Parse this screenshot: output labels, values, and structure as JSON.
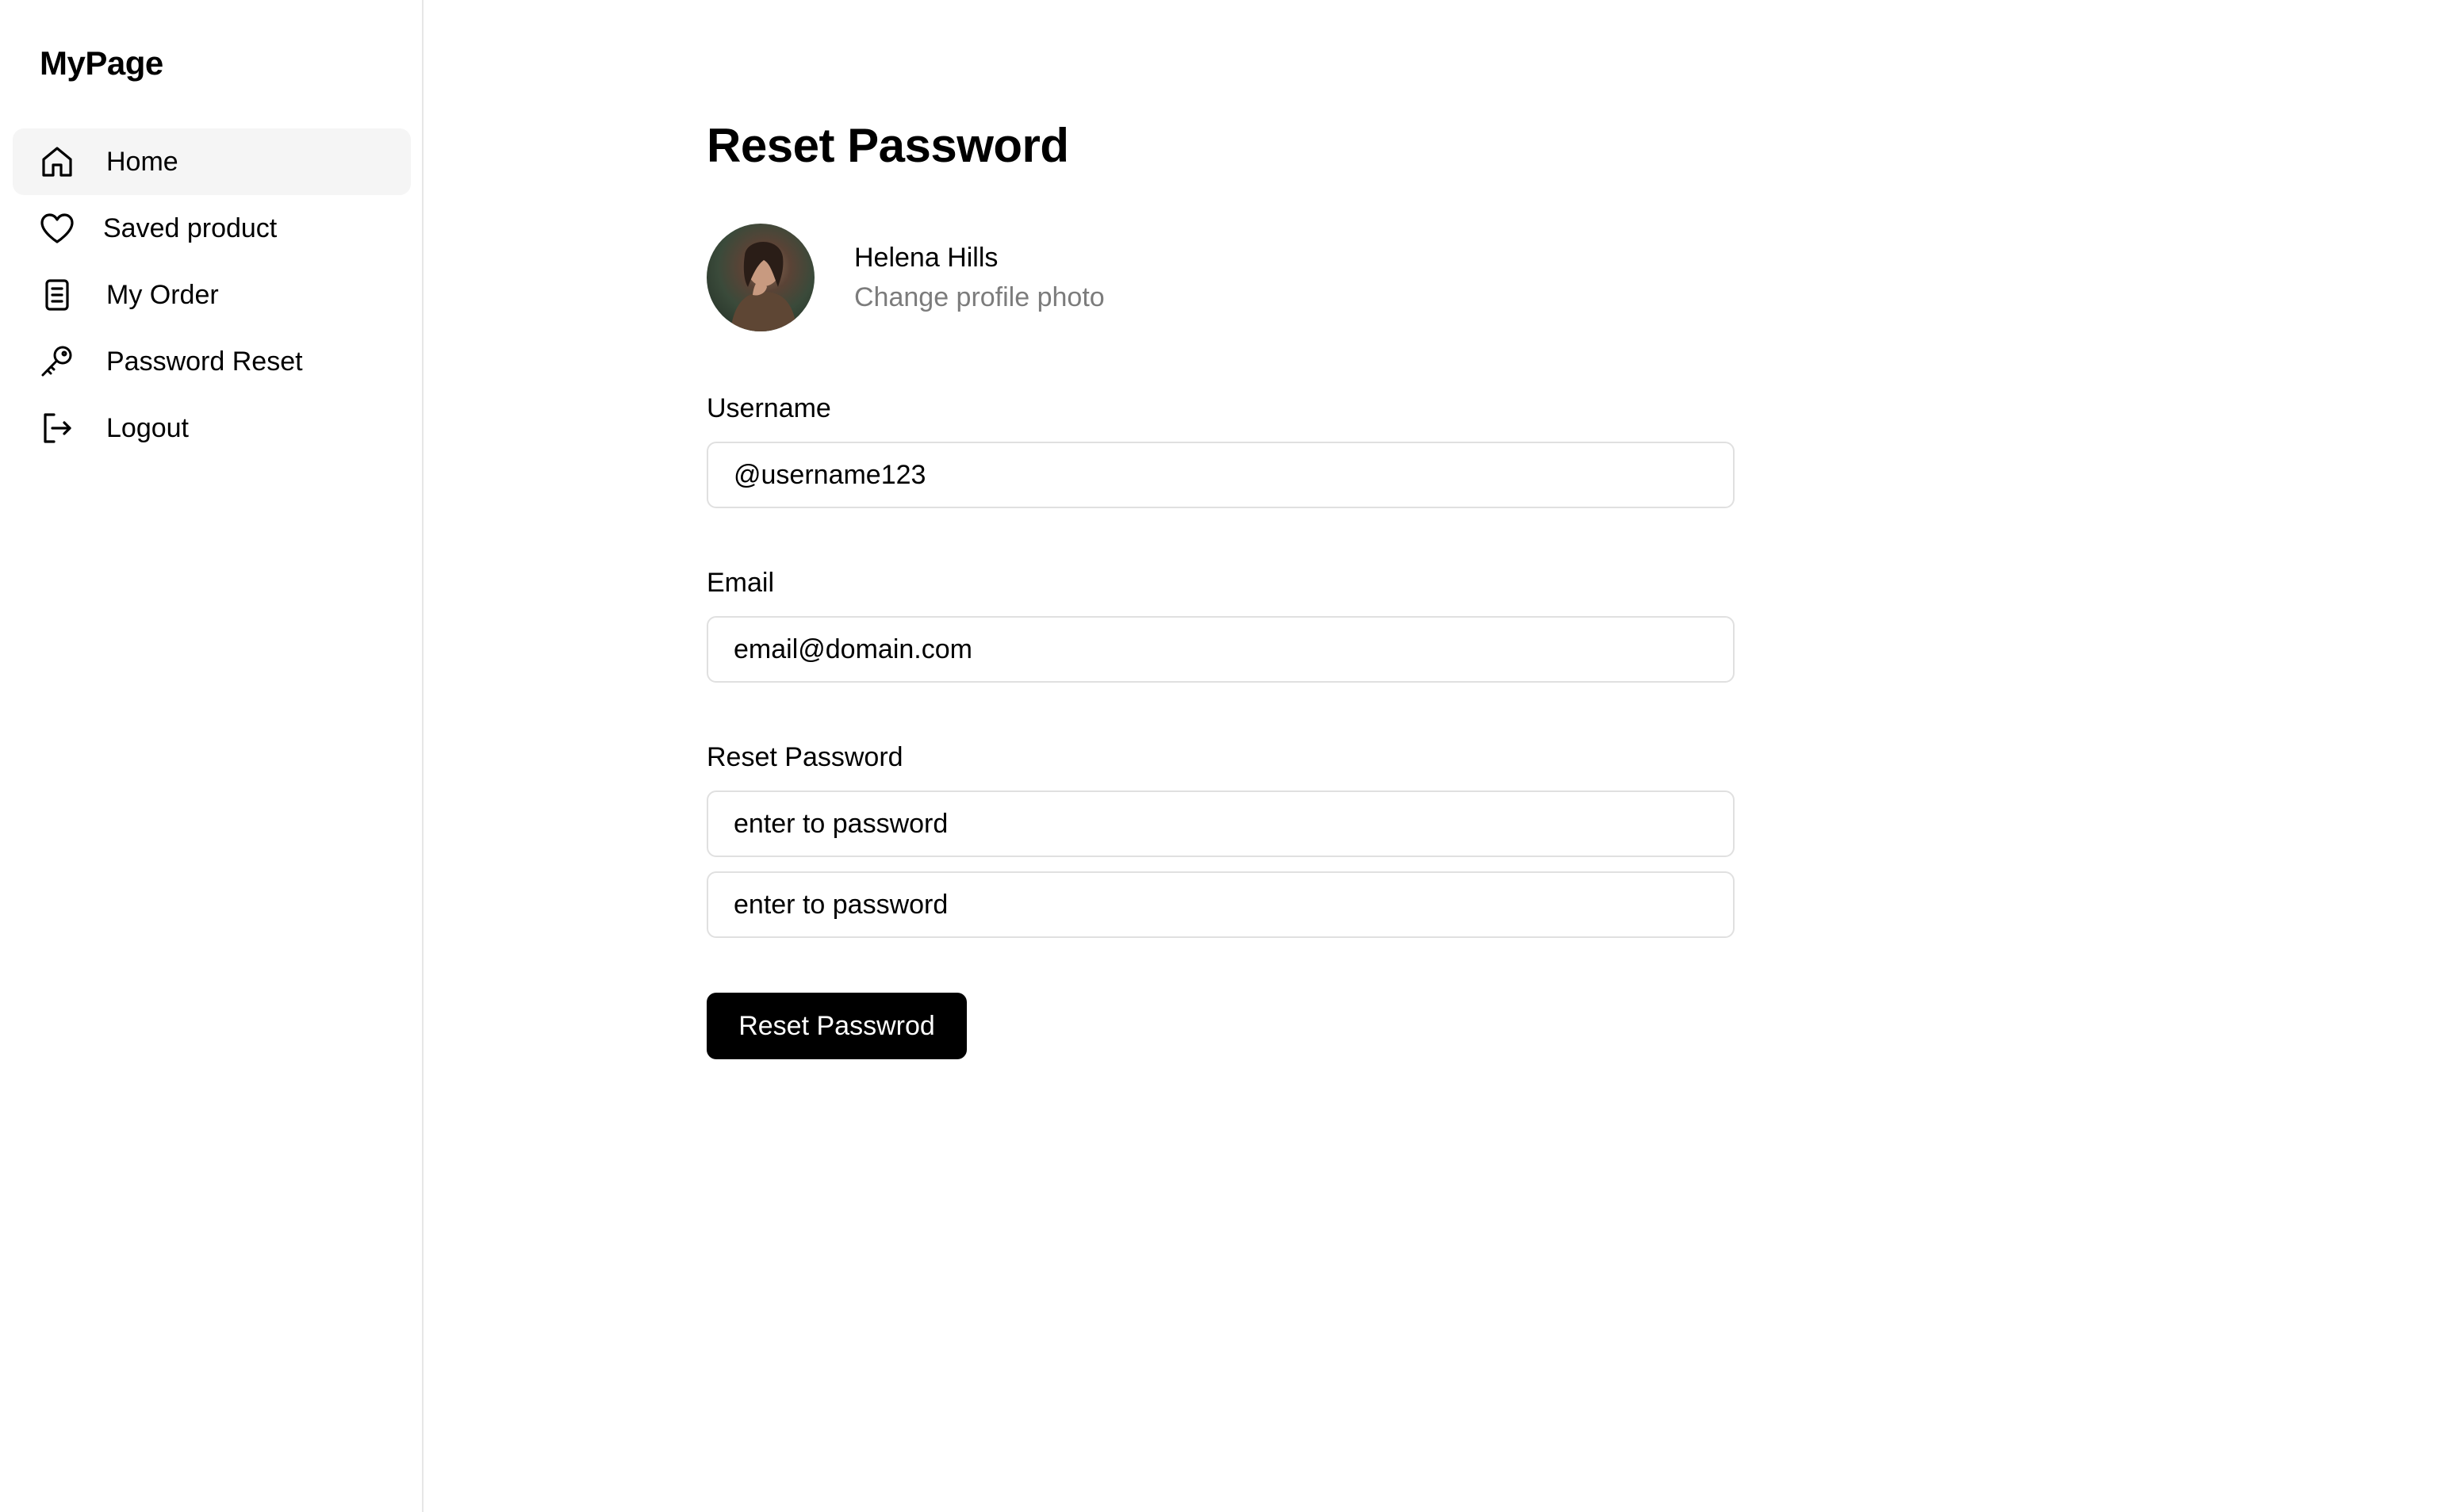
{
  "sidebar": {
    "brand": "MyPage",
    "items": [
      {
        "label": "Home",
        "icon": "home-icon",
        "active": true
      },
      {
        "label": "Saved product",
        "icon": "heart-icon"
      },
      {
        "label": "My Order",
        "icon": "document-icon"
      },
      {
        "label": "Password Reset",
        "icon": "key-icon"
      },
      {
        "label": "Logout",
        "icon": "logout-icon"
      }
    ]
  },
  "main": {
    "title": "Reset Password",
    "profile": {
      "name": "Helena Hills",
      "change_photo": "Change profile photo"
    },
    "username": {
      "label": "Username",
      "value": "@username123"
    },
    "email": {
      "label": "Email",
      "value": "email@domain.com"
    },
    "reset": {
      "label": "Reset Password",
      "placeholder_1": "enter to password",
      "placeholder_2": "enter to password"
    },
    "submit_label": "Reset Passwrod"
  }
}
